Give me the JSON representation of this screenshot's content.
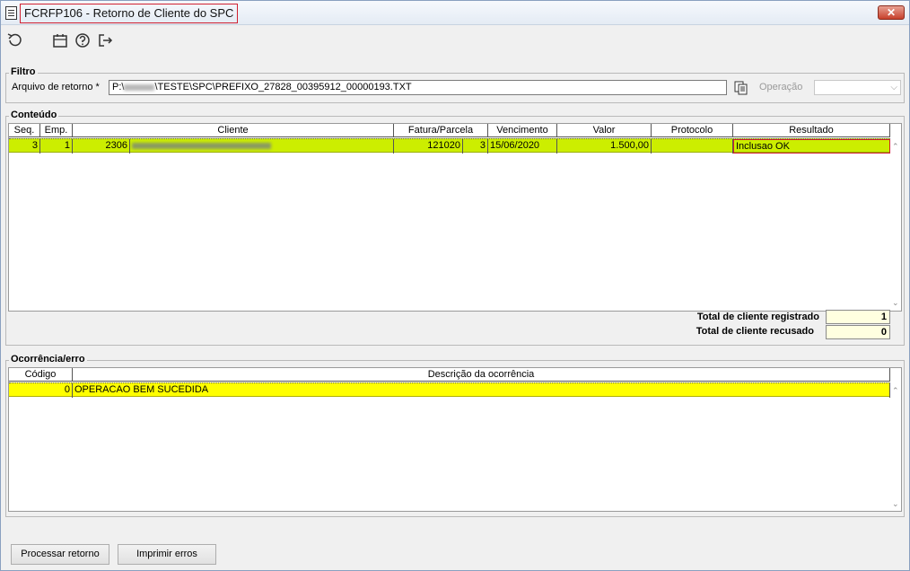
{
  "window": {
    "title": "FCRFP106 - Retorno de Cliente do SPC",
    "close_label": "✕"
  },
  "toolbar": {
    "icons": [
      "refresh-icon",
      "calendar-icon",
      "help-icon",
      "exit-icon"
    ]
  },
  "filtro": {
    "title": "Filtro",
    "arquivo_label": "Arquivo de retorno *",
    "arquivo_prefix": "P:\\",
    "arquivo_value": "\\TESTE\\SPC\\PREFIXO_27828_00395912_00000193.TXT",
    "operacao_label": "Operação",
    "operacao_value": ""
  },
  "conteudo": {
    "title": "Conteúdo",
    "columns": [
      "Seq.",
      "Emp.",
      "Cliente",
      "Fatura/Parcela",
      "Vencimento",
      "Valor",
      "Protocolo",
      "Resultado"
    ],
    "rows": [
      {
        "seq": "3",
        "emp": "1",
        "cliente_cod": "2306",
        "fatura": "121020",
        "parcela": "3",
        "vencimento": "15/06/2020",
        "valor": "1.500,00",
        "protocolo": "",
        "resultado": "Inclusao OK"
      }
    ],
    "total_registrado_label": "Total de cliente registrado",
    "total_registrado": "1",
    "total_recusado_label": "Total de cliente recusado",
    "total_recusado": "0"
  },
  "ocorrencia": {
    "title": "Ocorrência/erro",
    "columns": [
      "Código",
      "Descrição da ocorrência"
    ],
    "rows": [
      {
        "codigo": "0",
        "descricao": "OPERACAO BEM SUCEDIDA"
      }
    ]
  },
  "buttons": {
    "processar": "Processar retorno",
    "imprimir": "Imprimir erros"
  },
  "colors": {
    "row_highlight": "#ccee00",
    "error_row": "#ffff00",
    "title_border": "#d02030"
  }
}
